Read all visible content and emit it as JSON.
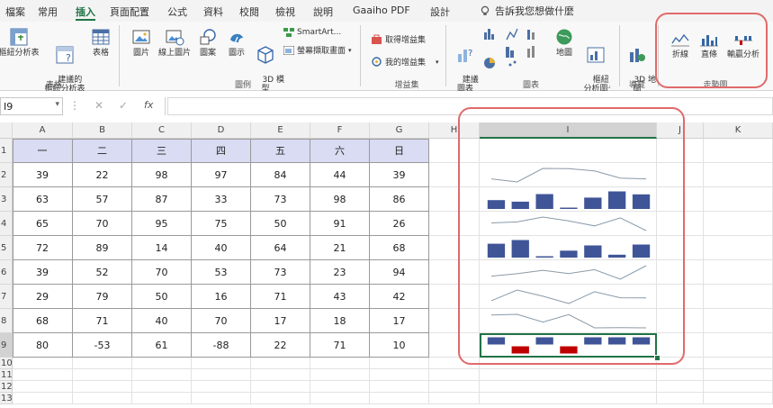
{
  "tabs": [
    "檔案",
    "常用",
    "插入",
    "頁面配置",
    "公式",
    "資料",
    "校閱",
    "檢視",
    "說明",
    "Gaaiho PDF",
    "設計"
  ],
  "active_tab": "插入",
  "tell_me": "告訴我您想做什麼",
  "ribbon": {
    "pivot_label": "樞紐分析表",
    "rec_pivot_label": "建議的\n樞紐分析表",
    "table_label": "表格",
    "grp_tables": "表格",
    "pictures_label": "圖片",
    "online_pictures_label": "線上圖片",
    "shapes_label": "圖案",
    "icons_label": "圖示",
    "models3d_label": "3D 模\n型",
    "smartart_label": "SmartArt...",
    "screenshot_label": "螢幕擷取畫面",
    "grp_illustrations": "圖例",
    "get_addins_label": "取得增益集",
    "my_addins_label": "我的增益集",
    "grp_addins": "增益集",
    "rec_charts_label": "建議\n圖表",
    "maps_label": "地圖",
    "pivot_chart_label": "樞紐\n分析圖",
    "grp_charts": "圖表",
    "map3d_label": "3D 地\n圖",
    "grp_tours": "導覽",
    "line_label": "折線",
    "column_label": "直條",
    "winloss_label": "輸贏分析",
    "grp_sparklines": "走勢圖"
  },
  "formula_bar": {
    "name_box": "I9",
    "fx": "fx",
    "value": ""
  },
  "columns": [
    "A",
    "B",
    "C",
    "D",
    "E",
    "F",
    "G",
    "H",
    "I",
    "J",
    "K"
  ],
  "selected_column": "I",
  "rows": [
    "1",
    "2",
    "3",
    "4",
    "5",
    "6",
    "7",
    "8",
    "9",
    "10",
    "11",
    "12",
    "13"
  ],
  "selected_row": "9",
  "table": {
    "headers": [
      "一",
      "二",
      "三",
      "四",
      "五",
      "六",
      "日"
    ],
    "rows": [
      [
        "39",
        "22",
        "98",
        "97",
        "84",
        "44",
        "39"
      ],
      [
        "63",
        "57",
        "87",
        "33",
        "73",
        "98",
        "86"
      ],
      [
        "65",
        "70",
        "95",
        "75",
        "50",
        "91",
        "26"
      ],
      [
        "72",
        "89",
        "14",
        "40",
        "64",
        "21",
        "68"
      ],
      [
        "39",
        "52",
        "70",
        "53",
        "73",
        "23",
        "94"
      ],
      [
        "29",
        "79",
        "50",
        "16",
        "71",
        "43",
        "42"
      ],
      [
        "68",
        "71",
        "40",
        "70",
        "17",
        "18",
        "17"
      ],
      [
        "80",
        "-53",
        "61",
        "-88",
        "22",
        "71",
        "10"
      ]
    ]
  },
  "sparklines": [
    {
      "type": "line",
      "values": [
        39,
        22,
        98,
        97,
        84,
        44,
        39
      ]
    },
    {
      "type": "column",
      "values": [
        63,
        57,
        87,
        33,
        73,
        98,
        86
      ]
    },
    {
      "type": "line",
      "values": [
        65,
        70,
        95,
        75,
        50,
        91,
        26
      ]
    },
    {
      "type": "column",
      "values": [
        72,
        89,
        14,
        40,
        64,
        21,
        68
      ]
    },
    {
      "type": "line",
      "values": [
        39,
        52,
        70,
        53,
        73,
        23,
        94
      ]
    },
    {
      "type": "line",
      "values": [
        29,
        79,
        50,
        16,
        71,
        43,
        42
      ]
    },
    {
      "type": "line",
      "values": [
        68,
        71,
        40,
        70,
        17,
        18,
        17
      ]
    },
    {
      "type": "winloss",
      "values": [
        80,
        -53,
        61,
        -88,
        22,
        71,
        10
      ]
    }
  ],
  "colors": {
    "accent": "#217346",
    "sparkline_line": "#8a9aa8",
    "column_fill": "#3f5597",
    "negative_fill": "#c00000",
    "highlight": "#e06a6a",
    "table_header": "#d9dcf2"
  }
}
